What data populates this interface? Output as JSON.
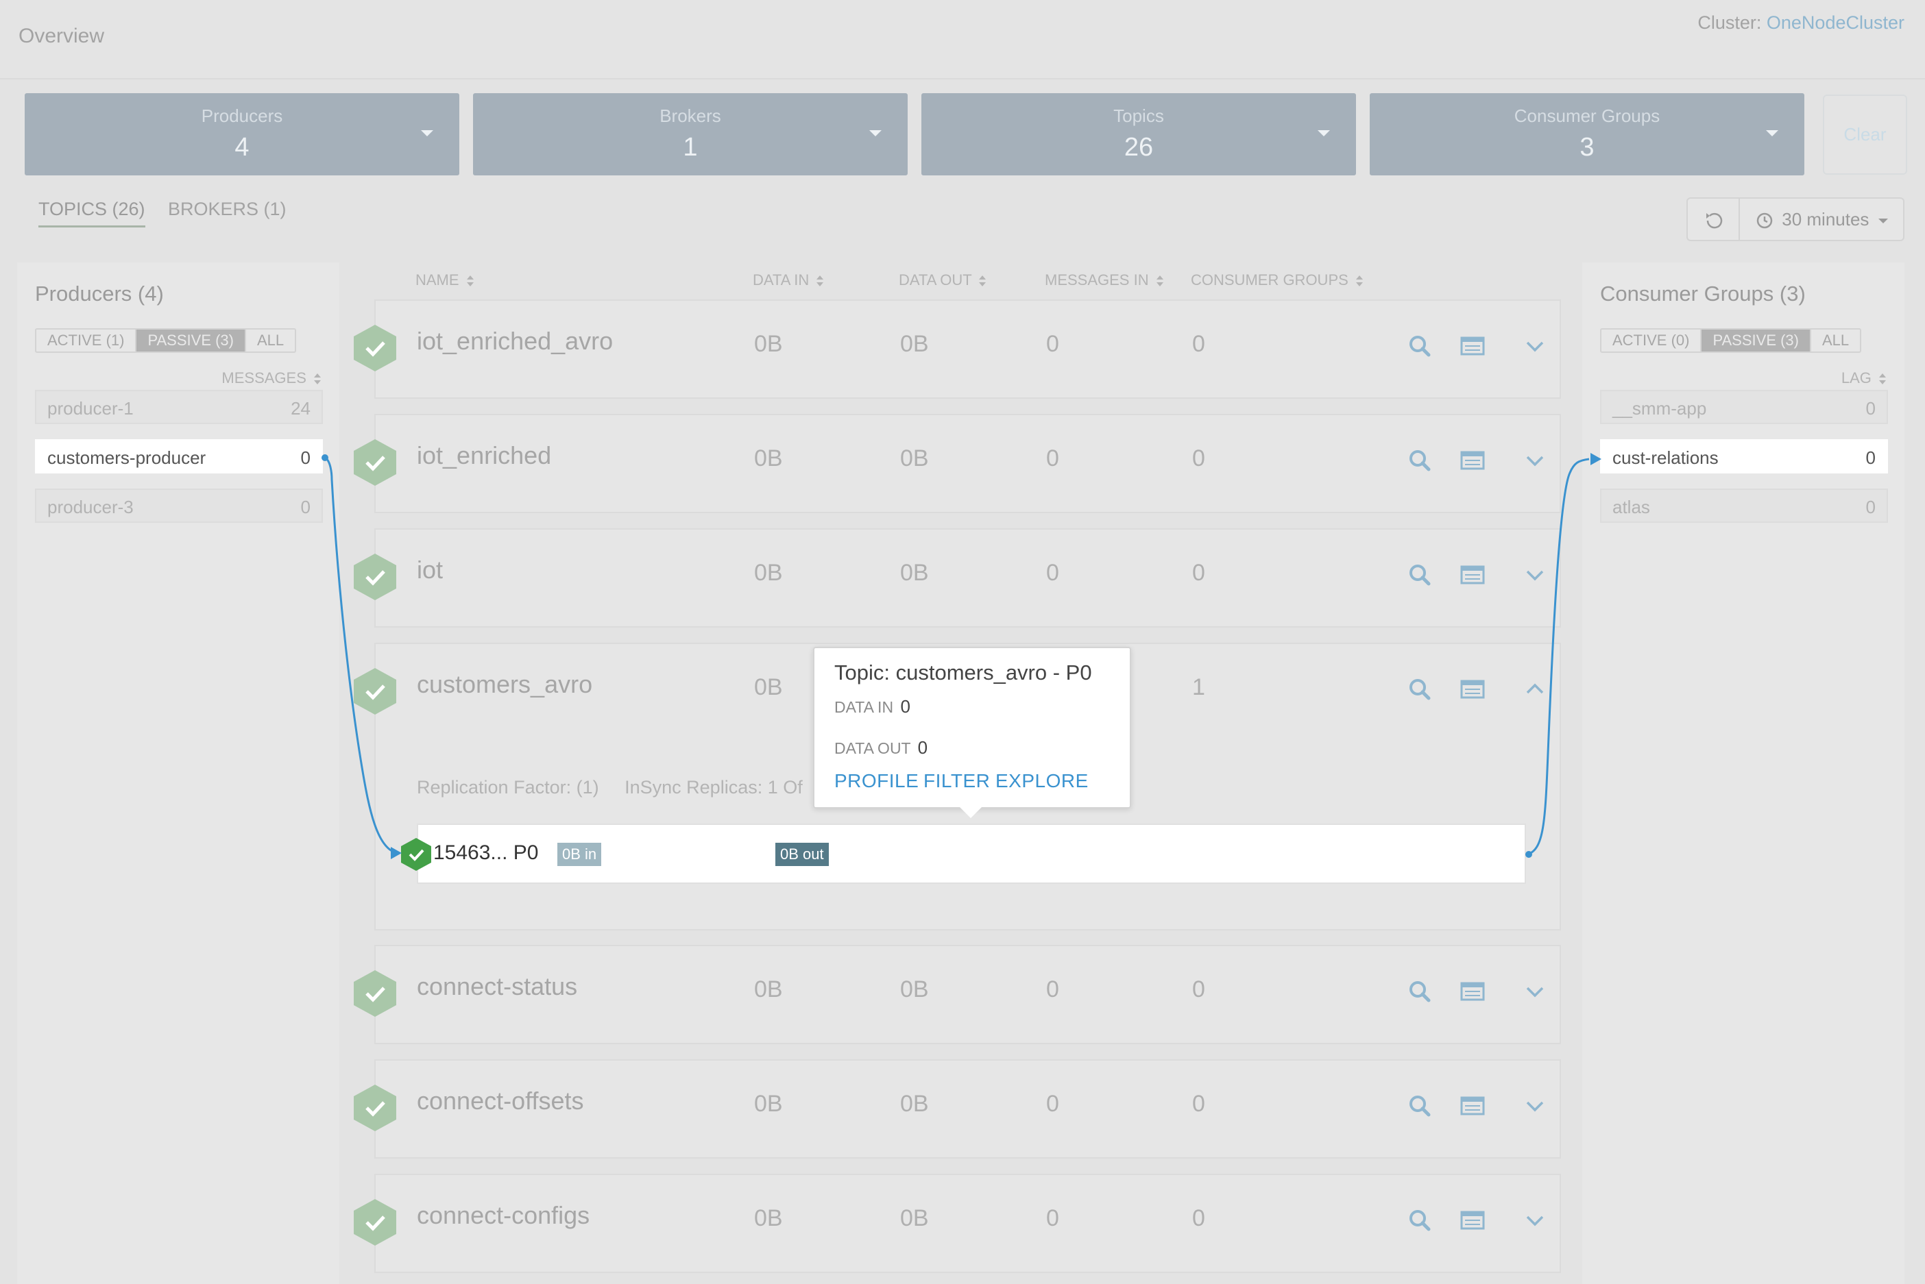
{
  "header": {
    "title": "Overview",
    "cluster_label": "Cluster:",
    "cluster_name": "OneNodeCluster"
  },
  "summary": [
    {
      "label": "Producers",
      "value": "4"
    },
    {
      "label": "Brokers",
      "value": "1"
    },
    {
      "label": "Topics",
      "value": "26"
    },
    {
      "label": "Consumer Groups",
      "value": "3"
    }
  ],
  "clear_label": "Clear",
  "tabs": [
    {
      "label": "TOPICS (26)",
      "active": true
    },
    {
      "label": "BROKERS (1)",
      "active": false
    }
  ],
  "time_range": "30 minutes",
  "producers_panel": {
    "title": "Producers (4)",
    "filters": [
      "ACTIVE (1)",
      "PASSIVE (3)",
      "ALL"
    ],
    "active_filter": "PASSIVE (3)",
    "column": "MESSAGES",
    "items": [
      {
        "name": "producer-1",
        "value": "24",
        "selected": false
      },
      {
        "name": "customers-producer",
        "value": "0",
        "selected": true
      },
      {
        "name": "producer-3",
        "value": "0",
        "selected": false
      }
    ]
  },
  "consumers_panel": {
    "title": "Consumer Groups (3)",
    "filters": [
      "ACTIVE (0)",
      "PASSIVE (3)",
      "ALL"
    ],
    "active_filter": "PASSIVE (3)",
    "column": "LAG",
    "items": [
      {
        "name": "__smm-app",
        "value": "0",
        "selected": false
      },
      {
        "name": "cust-relations",
        "value": "0",
        "selected": true
      },
      {
        "name": "atlas",
        "value": "0",
        "selected": false
      }
    ]
  },
  "topic_columns": [
    "NAME",
    "DATA IN",
    "DATA OUT",
    "MESSAGES IN",
    "CONSUMER GROUPS"
  ],
  "topics": [
    {
      "name": "iot_enriched_avro",
      "data_in": "0B",
      "data_out": "0B",
      "messages_in": "0",
      "consumer_groups": "0"
    },
    {
      "name": "iot_enriched",
      "data_in": "0B",
      "data_out": "0B",
      "messages_in": "0",
      "consumer_groups": "0"
    },
    {
      "name": "iot",
      "data_in": "0B",
      "data_out": "0B",
      "messages_in": "0",
      "consumer_groups": "0"
    },
    {
      "name": "customers_avro",
      "data_in": "0B",
      "data_out": "",
      "messages_in": "",
      "consumer_groups": "1",
      "expanded": true
    },
    {
      "name": "connect-status",
      "data_in": "0B",
      "data_out": "0B",
      "messages_in": "0",
      "consumer_groups": "0"
    },
    {
      "name": "connect-offsets",
      "data_in": "0B",
      "data_out": "0B",
      "messages_in": "0",
      "consumer_groups": "0"
    },
    {
      "name": "connect-configs",
      "data_in": "0B",
      "data_out": "0B",
      "messages_in": "0",
      "consumer_groups": "0"
    }
  ],
  "expanded": {
    "replication": "Replication Factor: (1)",
    "insync": "InSync Replicas: 1 Of",
    "partition_id": "15463... P0",
    "pill_in": "0B in",
    "pill_out": "0B out"
  },
  "tooltip": {
    "title": "Topic: customers_avro - P0",
    "data_in_label": "DATA IN",
    "data_in_value": "0",
    "data_out_label": "DATA OUT",
    "data_out_value": "0",
    "links": [
      "PROFILE",
      "FILTER",
      "EXPLORE"
    ]
  },
  "colors": {
    "status_ok_faded": "#a9c7a9",
    "status_ok": "#43a047",
    "link": "#3a92cf",
    "flow_line": "#3a92cf"
  }
}
